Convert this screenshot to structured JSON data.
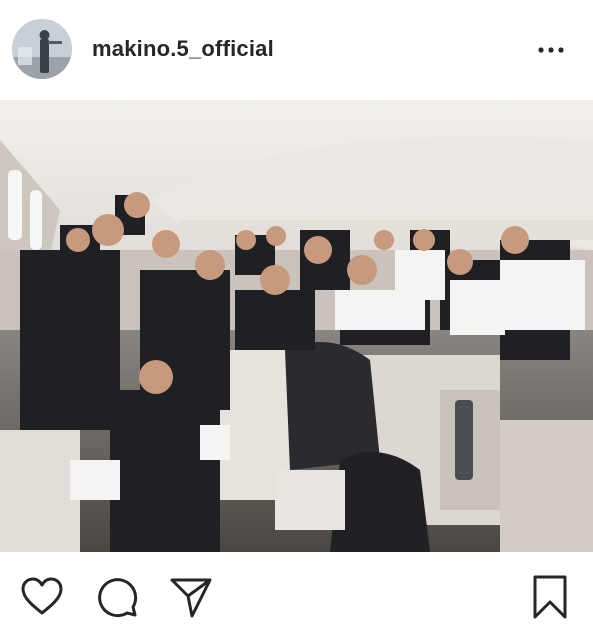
{
  "post": {
    "username": "makino.5_official"
  },
  "icons": {
    "avatar": "profile-avatar",
    "more": "more-options-icon",
    "like": "heart-icon",
    "comment": "comment-bubble-icon",
    "share": "paper-plane-icon",
    "save": "bookmark-icon"
  },
  "colors": {
    "text": "#262626",
    "icon_stroke": "#262626",
    "background": "#ffffff"
  }
}
